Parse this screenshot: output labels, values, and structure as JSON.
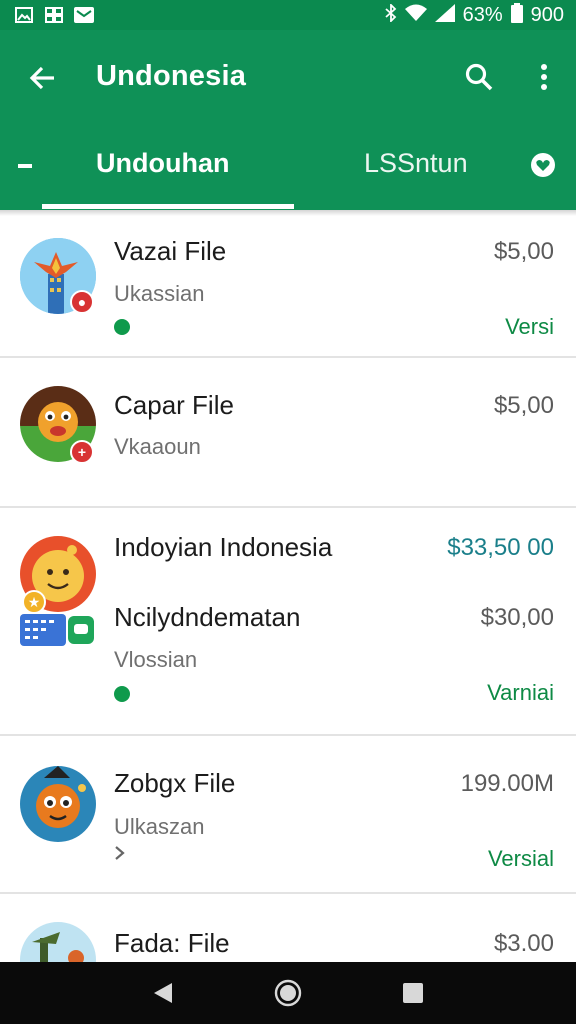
{
  "status_bar": {
    "battery_text": "63%",
    "time": "900"
  },
  "app_bar": {
    "title": "Undonesia"
  },
  "tabs": [
    {
      "label": "Undouhan",
      "active": true
    },
    {
      "label": "LSSntun",
      "active": false
    }
  ],
  "items": [
    {
      "title": "Vazai File",
      "price": "$5,00",
      "subtitle": "Ukassian",
      "status": "Versi"
    },
    {
      "title": "Capar File",
      "price": "$5,00",
      "subtitle": "Vkaaoun",
      "status": ""
    },
    {
      "title": "Indoyian Indonesia",
      "price": "$33,50 00",
      "title2": "Ncilydndematan",
      "price2": "$30,00",
      "subtitle": "Vlossian",
      "status": "Varniai"
    },
    {
      "title": "Zobgx File",
      "price": "199.00M",
      "subtitle": "Ulkaszan",
      "status": "Versial"
    },
    {
      "title": "Fada: File",
      "price": "$3.00"
    }
  ],
  "colors": {
    "primary": "#0f9157",
    "status_green": "#0e8a45",
    "badge_red": "#d83333",
    "teal_price": "#1a7f8a"
  },
  "icons": {
    "back": "arrow-left-icon",
    "search": "search-icon",
    "menu": "more-vert-icon",
    "nav_back": "triangle-back-icon",
    "nav_home": "circle-home-icon",
    "nav_recent": "square-recent-icon"
  }
}
